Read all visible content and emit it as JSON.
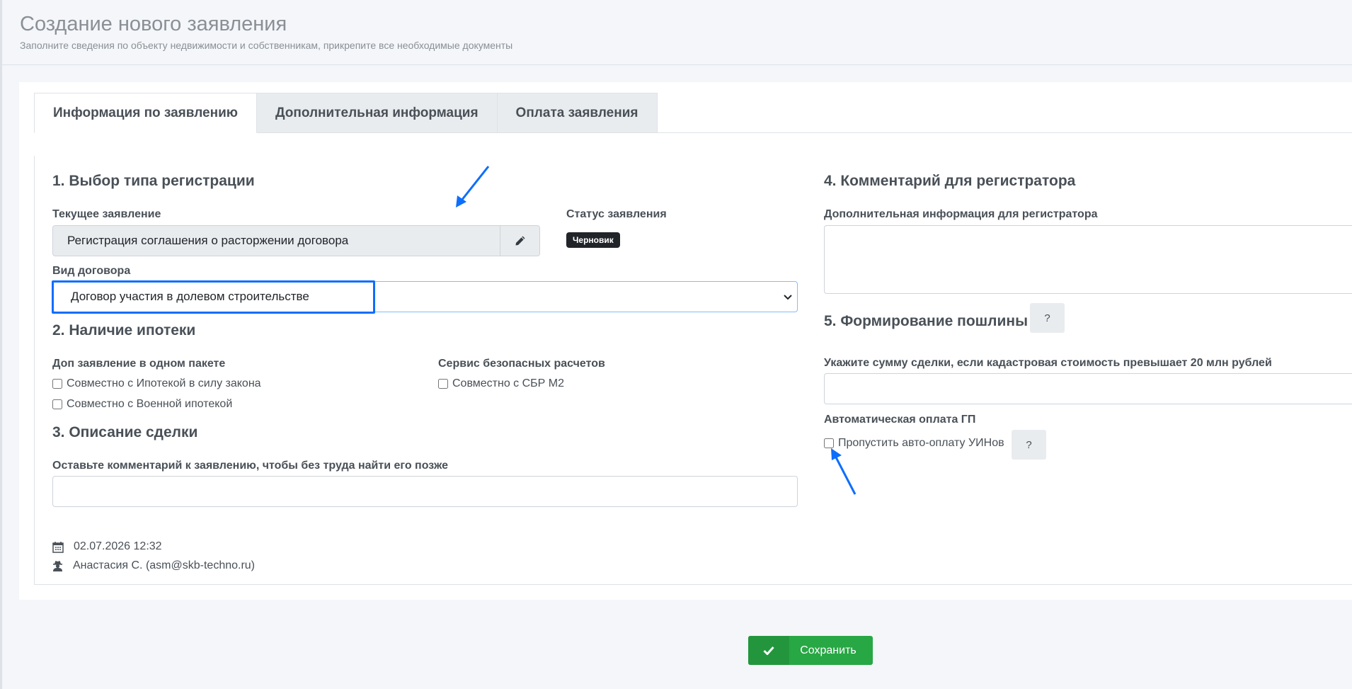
{
  "page": {
    "title": "Создание нового заявления",
    "subtitle": "Заполните сведения по объекту недвижимости и собственникам, прикрепите все необходимые документы"
  },
  "tabs": [
    {
      "label": "Информация по заявлению",
      "active": true
    },
    {
      "label": "Дополнительная информация",
      "active": false
    },
    {
      "label": "Оплата заявления",
      "active": false
    }
  ],
  "section1": {
    "title": "1. Выбор типа регистрации",
    "current_label": "Текущее заявление",
    "current_value": "Регистрация соглашения о расторжении договора",
    "status_label": "Статус заявления",
    "status_value": "Черновик",
    "contract_label": "Вид договора",
    "contract_value": "Договор участия в долевом строительстве"
  },
  "section2": {
    "title": "2. Наличие ипотеки",
    "package_label": "Доп заявление в одном пакете",
    "package_options": [
      "Совместно с Ипотекой в силу закона",
      "Совместно с Военной ипотекой"
    ],
    "safe_label": "Сервис безопасных расчетов",
    "safe_options": [
      "Совместно с СБР М2"
    ]
  },
  "section3": {
    "title": "3. Описание сделки",
    "comment_label": "Оставьте комментарий к заявлению, чтобы без труда найти его позже"
  },
  "meta": {
    "date": "02.07.2026 12:32",
    "user": "Анастасия С. (asm@skb-techno.ru)"
  },
  "section4": {
    "title": "4. Комментарий для регистратора",
    "extra_label": "Дополнительная информация для регистратора"
  },
  "section5": {
    "title": "5. Формирование пошлины",
    "help": "?",
    "sum_label": "Укажите сумму сделки, если кадастровая стоимость превышает 20 млн рублей",
    "auto_label": "Автоматическая оплата ГП",
    "skip_label": "Пропустить авто-оплату УИНов",
    "skip_help": "?"
  },
  "actions": {
    "save_label": "Сохранить"
  },
  "colors": {
    "annotation_blue": "#0d6efd",
    "save_green": "#28a745",
    "badge_dark": "#212529"
  }
}
